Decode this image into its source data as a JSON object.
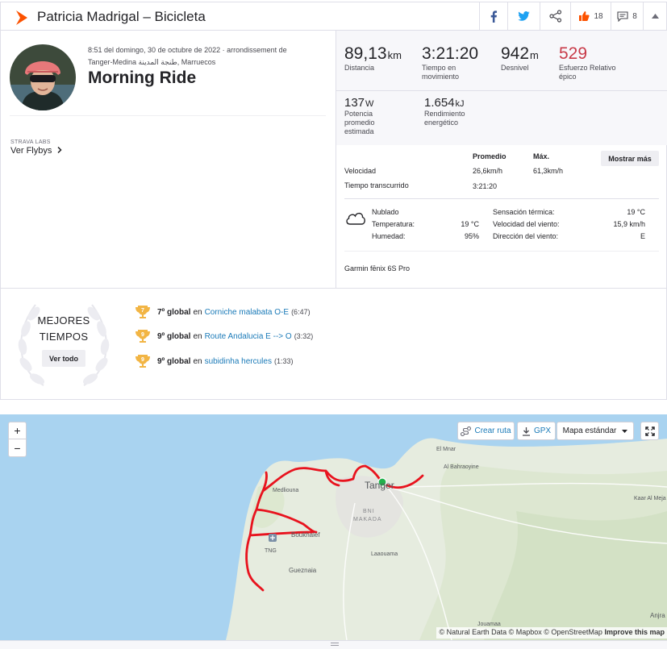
{
  "header": {
    "title": "Patricia Madrigal – Bicicleta",
    "kudos_count": "18",
    "comment_count": "8"
  },
  "activity": {
    "datetime": "8:51 del domingo, 30 de octubre de 2022 · arrondissement de",
    "location": "Tanger-Medina طنجة المدينة, Marruecos",
    "name": "Morning Ride",
    "labs_label": "STRAVA LABS",
    "flybys_label": "Ver Flybys",
    "device": "Garmin fēnix 6S Pro"
  },
  "stats": {
    "distance": {
      "value": "89,13",
      "unit": "km",
      "label": "Distancia"
    },
    "moving_time": {
      "value": "3:21:20",
      "label1": "Tiempo en",
      "label2": "movimiento"
    },
    "elevation": {
      "value": "942",
      "unit": "m",
      "label": "Desnivel"
    },
    "relative_effort": {
      "value": "529",
      "label1": "Esfuerzo Relativo",
      "label2": "épico"
    },
    "power": {
      "value": "137",
      "unit": "W",
      "label1": "Potencia",
      "label2": "promedio",
      "label3": "estimada"
    },
    "energy": {
      "value": "1.654",
      "unit": "kJ",
      "label1": "Rendimiento",
      "label2": "energético"
    }
  },
  "details": {
    "col_avg": "Promedio",
    "col_max": "Máx.",
    "show_more": "Mostrar más",
    "speed_label": "Velocidad",
    "speed_avg": "26,6km/h",
    "speed_max": "61,3km/h",
    "elapsed_label": "Tiempo transcurrido",
    "elapsed_value": "3:21:20"
  },
  "weather": {
    "condition": "Nublado",
    "temp_label": "Temperatura:",
    "temp_value": "19 °C",
    "humidity_label": "Humedad:",
    "humidity_value": "95%",
    "feels_label": "Sensación térmica:",
    "feels_value": "19 °C",
    "wind_speed_label": "Velocidad del viento:",
    "wind_speed_value": "15,9 km/h",
    "wind_dir_label": "Dirección del viento:",
    "wind_dir_value": "E"
  },
  "best_efforts": {
    "title_line1": "MEJORES",
    "title_line2": "TIEMPOS",
    "see_all": "Ver todo",
    "items": [
      {
        "rank": "7º global",
        "sep": "en",
        "segment": "Corniche malabata O-E",
        "time": "(6:47)",
        "trophy": "7"
      },
      {
        "rank": "9º global",
        "sep": "en",
        "segment": "Route Andalucia E --> O",
        "time": "(3:32)",
        "trophy": "9"
      },
      {
        "rank": "9º global",
        "sep": "en",
        "segment": "subidinha hercules",
        "time": "(1:33)",
        "trophy": "9"
      }
    ]
  },
  "map": {
    "zoom_in": "+",
    "zoom_out": "−",
    "create_route": "Crear ruta",
    "gpx": "GPX",
    "map_style": "Mapa estándar",
    "labels": {
      "tanger": "Tanger",
      "el_mnar": "El Mnar",
      "al_bahraoyine": "Al Bahraoyine",
      "medliouna": "Medliouna",
      "bni_makada_1": "BNI",
      "bni_makada_2": "MAKADA",
      "boukhalef": "Boukhalef",
      "tng": "TNG",
      "laaouama": "Laaouama",
      "gueznaia": "Gueznaia",
      "kaar": "Kaar Al Meja",
      "jouamaa": "Jouamaa",
      "anjra": "Anjra"
    },
    "attribution_prefix": "© Natural Earth Data © Mapbox © OpenStreetMap",
    "attribution_link": "Improve this map"
  },
  "colors": {
    "strava_orange": "#fc5200",
    "link_blue": "#1a7ab8",
    "route_red": "#e8131e",
    "relative_effort": "#c83a48",
    "trophy_gold": "#f2b544"
  }
}
